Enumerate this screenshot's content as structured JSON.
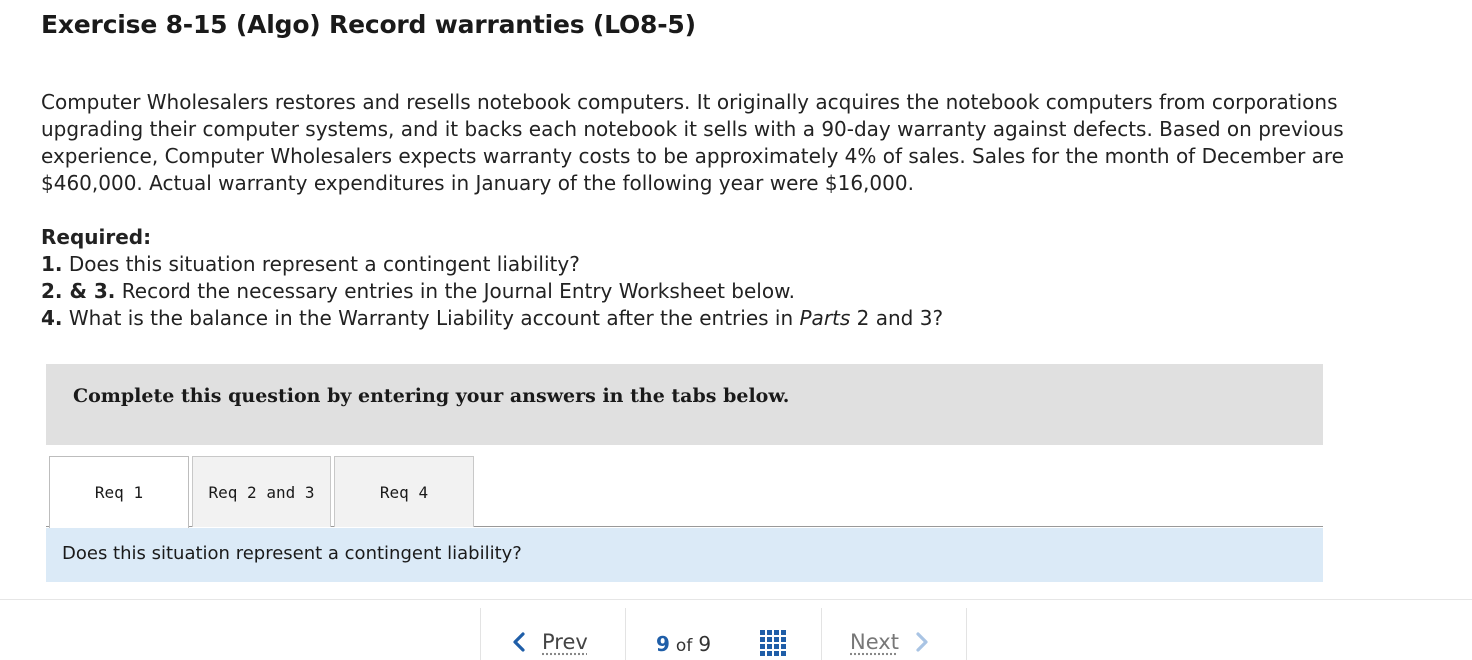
{
  "exercise": {
    "title": "Exercise 8-15 (Algo) Record warranties (LO8-5)"
  },
  "problem": {
    "text": "Computer Wholesalers restores and resells notebook computers. It originally acquires the notebook computers from corporations upgrading their computer systems, and it backs each notebook it sells with a 90-day warranty against defects. Based on previous experience, Computer Wholesalers expects warranty costs to be approximately 4% of sales. Sales for the month of December are $460,000. Actual warranty expenditures in January of the following year were $16,000."
  },
  "required": {
    "heading": "Required:",
    "items": [
      {
        "num": "1.",
        "text": " Does this situation represent a contingent liability?"
      },
      {
        "num": "2. & 3.",
        "text": " Record the necessary entries in the Journal Entry Worksheet below."
      },
      {
        "num": "4.",
        "text_before": " What is the balance in the Warranty Liability account after the entries in ",
        "italic": "Parts",
        "text_after": " 2 and 3?"
      }
    ]
  },
  "instructions": {
    "complete_text": "Complete this question by entering your answers in the tabs below."
  },
  "tabs": [
    {
      "label": "Req 1",
      "active": true
    },
    {
      "label": "Req 2 and 3",
      "active": false
    },
    {
      "label": "Req 4",
      "active": false
    }
  ],
  "active_question": "Does this situation represent a contingent liability?",
  "footer": {
    "prev_label": "Prev",
    "current_page": "9",
    "of_label": "of",
    "total_pages": "9",
    "next_label": "Next",
    "grid_icon": "grid-icon"
  },
  "colors": {
    "accent_blue": "#1f5ea8",
    "question_bg": "#dbeaf7",
    "instruction_bg": "#e0e0e0",
    "next_chevron": "#a9c4e4"
  }
}
